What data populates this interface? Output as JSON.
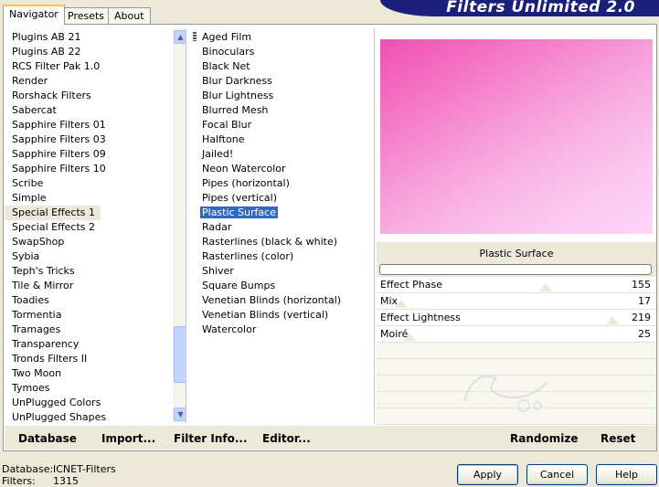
{
  "app": {
    "title": "Filters Unlimited 2.0",
    "colors": {
      "banner": "#1a1f7a",
      "selection": "#316ac5",
      "preview_start": "#f050b0",
      "preview_end": "#fdd5f7"
    }
  },
  "tabs": [
    {
      "label": "Navigator",
      "active": true
    },
    {
      "label": "Presets",
      "active": false
    },
    {
      "label": "About",
      "active": false
    }
  ],
  "categories": {
    "items": [
      "Plugins AB 21",
      "Plugins AB 22",
      "RCS Filter Pak 1.0",
      "Render",
      "Rorshack Filters",
      "Sabercat",
      "Sapphire Filters 01",
      "Sapphire Filters 03",
      "Sapphire Filters 09",
      "Sapphire Filters 10",
      "Scribe",
      "Simple",
      "Special Effects 1",
      "Special Effects 2",
      "SwapShop",
      "Sybia",
      "Teph's Tricks",
      "Tile & Mirror",
      "Toadies",
      "Tormentia",
      "Tramages",
      "Transparency",
      "Tronds Filters II",
      "Two Moon",
      "Tymoes",
      "UnPlugged Colors",
      "UnPlugged Shapes"
    ],
    "selected": "Special Effects 1"
  },
  "filters": {
    "items": [
      "Aged Film",
      "Binoculars",
      "Black Net",
      "Blur Darkness",
      "Blur Lightness",
      "Blurred Mesh",
      "Focal Blur",
      "Halftone",
      "Jailed!",
      "Neon Watercolor",
      "Pipes (horizontal)",
      "Pipes (vertical)",
      "Plastic Surface",
      "Radar",
      "Rasterlines (black & white)",
      "Rasterlines (color)",
      "Shiver",
      "Square Bumps",
      "Venetian Blinds (horizontal)",
      "Venetian Blinds (vertical)",
      "Watercolor"
    ],
    "selected": "Plastic Surface"
  },
  "preview": {
    "filter_name": "Plastic Surface"
  },
  "parameters": [
    {
      "label": "Effect Phase",
      "value": "155",
      "level": 0.61
    },
    {
      "label": "Mix",
      "value": "17",
      "level": 0.07
    },
    {
      "label": "Effect Lightness",
      "value": "219",
      "level": 0.86
    },
    {
      "label": "Moiré",
      "value": "25",
      "level": 0.1
    }
  ],
  "bottom_links": {
    "database": "Database",
    "import": "Import...",
    "filter_info": "Filter Info...",
    "editor": "Editor...",
    "randomize": "Randomize",
    "reset": "Reset"
  },
  "footer": {
    "database_label": "Database:",
    "database_value": "ICNET-Filters",
    "filters_label": "Filters:",
    "filters_value": "1315"
  },
  "buttons": {
    "apply": "Apply",
    "cancel": "Cancel",
    "help": "Help"
  }
}
